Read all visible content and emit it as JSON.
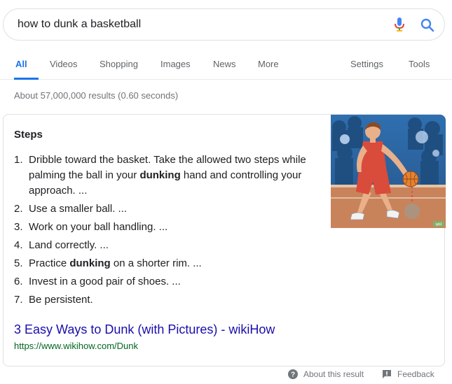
{
  "search": {
    "query": "how to dunk a basketball"
  },
  "tabs": {
    "all": "All",
    "videos": "Videos",
    "shopping": "Shopping",
    "images": "Images",
    "news": "News",
    "more": "More",
    "settings": "Settings",
    "tools": "Tools"
  },
  "result_stats": "About 57,000,000 results (0.60 seconds)",
  "snippet": {
    "heading": "Steps",
    "steps": [
      {
        "num": "1.",
        "parts": [
          "Dribble toward the basket. Take the allowed two steps while palming the ball in your ",
          "dunking",
          " hand and controlling your approach. ..."
        ]
      },
      {
        "num": "2.",
        "text": "Use a smaller ball. ..."
      },
      {
        "num": "3.",
        "text": "Work on your ball handling. ..."
      },
      {
        "num": "4.",
        "text": "Land correctly. ..."
      },
      {
        "num": "5.",
        "parts": [
          "Practice ",
          "dunking",
          " on a shorter rim. ..."
        ]
      },
      {
        "num": "6.",
        "text": "Invest in a good pair of shoes. ..."
      },
      {
        "num": "7.",
        "text": "Be persistent."
      }
    ],
    "source_title": "3 Easy Ways to Dunk (with Pictures) - wikiHow",
    "source_url": "https://www.wikihow.com/Dunk",
    "image_badge": "wH"
  },
  "footer": {
    "about": "About this result",
    "feedback": "Feedback"
  },
  "colors": {
    "accent": "#1a73e8",
    "link": "#1a0dab",
    "url": "#006621"
  }
}
